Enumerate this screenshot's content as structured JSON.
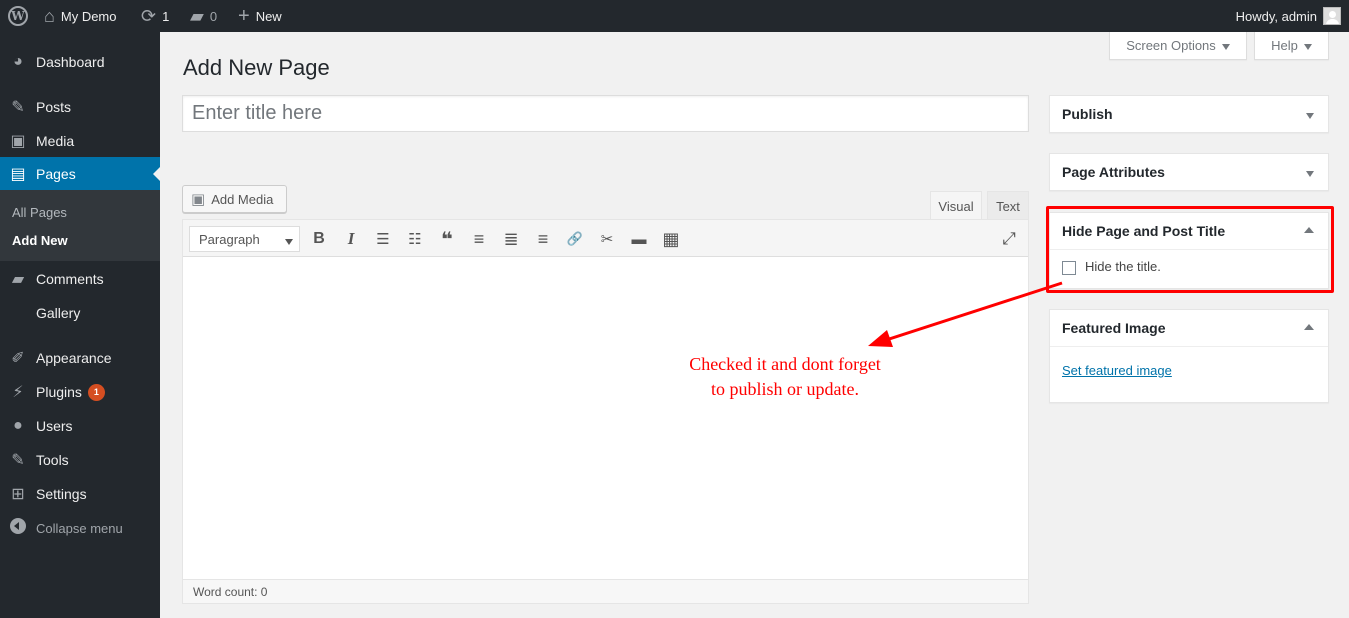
{
  "adminbar": {
    "site_name": "My Demo",
    "updates_count": "1",
    "comments_count": "0",
    "new_label": "New",
    "howdy": "Howdy, admin",
    "wp_logo_glyph": "W"
  },
  "sidebar": {
    "items": [
      {
        "label": "Dashboard",
        "icon": "dashboard-icon",
        "glyph": "◕"
      },
      {
        "label": "Posts",
        "icon": "pin-icon",
        "glyph": "✎"
      },
      {
        "label": "Media",
        "icon": "media-icon",
        "glyph": "▣"
      },
      {
        "label": "Pages",
        "icon": "pages-icon",
        "glyph": "▤"
      },
      {
        "label": "Comments",
        "icon": "comment-icon",
        "glyph": "▰"
      },
      {
        "label": "Gallery",
        "icon": "",
        "glyph": ""
      },
      {
        "label": "Appearance",
        "icon": "paintbrush-icon",
        "glyph": "✐"
      },
      {
        "label": "Plugins",
        "icon": "plugin-icon",
        "glyph": "⚡",
        "badge": "1"
      },
      {
        "label": "Users",
        "icon": "user-icon",
        "glyph": "●"
      },
      {
        "label": "Tools",
        "icon": "wrench-icon",
        "glyph": "✎"
      },
      {
        "label": "Settings",
        "icon": "settings-icon",
        "glyph": "⊞"
      }
    ],
    "submenu": [
      "All Pages",
      "Add New"
    ],
    "collapse_label": "Collapse menu"
  },
  "screen_meta": {
    "screen_options": "Screen Options",
    "help": "Help"
  },
  "main": {
    "title": "Add New Page",
    "title_placeholder": "Enter title here",
    "title_value": "",
    "add_media": "Add Media",
    "tabs": [
      "Visual",
      "Text"
    ],
    "active_tab": "Visual",
    "format_select": "Paragraph",
    "toolbar_buttons": [
      {
        "name": "bold-icon",
        "glyph": "B"
      },
      {
        "name": "italic-icon",
        "glyph": "I"
      },
      {
        "name": "bullet-list-icon",
        "glyph": "☰"
      },
      {
        "name": "numbered-list-icon",
        "glyph": "☷"
      },
      {
        "name": "blockquote-icon",
        "glyph": "❝"
      },
      {
        "name": "align-left-icon",
        "glyph": "≡"
      },
      {
        "name": "align-center-icon",
        "glyph": "≣"
      },
      {
        "name": "align-right-icon",
        "glyph": "≡"
      },
      {
        "name": "link-icon",
        "glyph": "🔗"
      },
      {
        "name": "unlink-icon",
        "glyph": "✂"
      },
      {
        "name": "read-more-icon",
        "glyph": "▬"
      },
      {
        "name": "toolbar-toggle-icon",
        "glyph": "▦"
      }
    ],
    "fullscreen_glyph": "⤢",
    "word_count": "Word count: 0"
  },
  "metaboxes": {
    "publish": "Publish",
    "page_attributes": "Page Attributes",
    "hide_title": {
      "heading": "Hide Page and Post Title",
      "checkbox_label": "Hide the title.",
      "checked": false
    },
    "featured_image": {
      "heading": "Featured Image",
      "link": "Set featured image"
    }
  },
  "annotation": {
    "line1": "Checked it and dont forget",
    "line2": "to publish or update.",
    "color": "#ff0000"
  },
  "colors": {
    "adminbar_bg": "#23282d",
    "menu_current": "#0073aa",
    "badge": "#d54e21",
    "link": "#0073aa"
  }
}
